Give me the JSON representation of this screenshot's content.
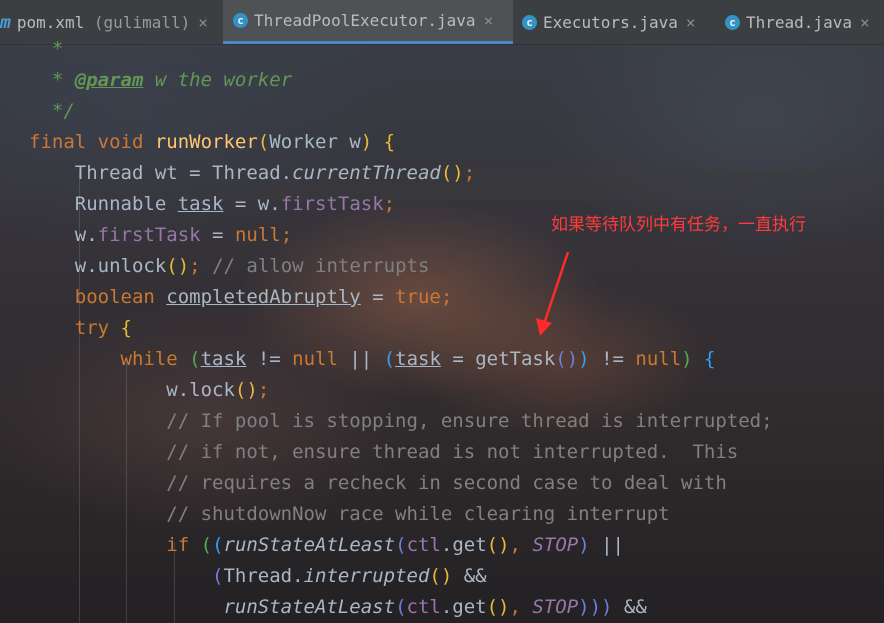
{
  "tabs": [
    {
      "icon": "m",
      "name": "pom.xml",
      "suffix": " (gulimall)",
      "close": "×"
    },
    {
      "icon": "c",
      "name": "ThreadPoolExecutor.java",
      "suffix": "",
      "close": "×"
    },
    {
      "icon": "c",
      "name": "Executors.java",
      "suffix": "",
      "close": "×"
    },
    {
      "icon": "c",
      "name": "Thread.java",
      "suffix": "",
      "close": "×"
    }
  ],
  "annotation": "如果等待队列中有任务，一直执行",
  "colors": {
    "annotation": "#ff3b3b",
    "keyword": "#cc7832",
    "function": "#ffc66d",
    "comment": "#808080",
    "doc": "#629755",
    "field": "#9876aa"
  },
  "code": [
    {
      "indent": "  ",
      "tokens": [
        {
          "t": "*",
          "c": "doc"
        }
      ]
    },
    {
      "indent": "  ",
      "tokens": [
        {
          "t": "* ",
          "c": "doc"
        },
        {
          "t": "@param",
          "c": "tag"
        },
        {
          "t": " w the worker",
          "c": "doc"
        }
      ]
    },
    {
      "indent": "  ",
      "tokens": [
        {
          "t": "*/",
          "c": "doc"
        }
      ]
    },
    {
      "indent": "",
      "tokens": [
        {
          "t": "final void ",
          "c": "kw"
        },
        {
          "t": "runWorker",
          "c": "fn"
        },
        {
          "t": "(",
          "c": "p1"
        },
        {
          "t": "Worker w",
          "c": ""
        },
        {
          "t": ")",
          "c": "p1"
        },
        {
          "t": " {",
          "c": "p1"
        }
      ]
    },
    {
      "indent": "    ",
      "tokens": [
        {
          "t": "Thread wt = Thread.",
          "c": ""
        },
        {
          "t": "currentThread",
          "c": "stat"
        },
        {
          "t": "()",
          "c": "p1"
        },
        {
          "t": ";",
          "c": "kw"
        }
      ]
    },
    {
      "indent": "    ",
      "tokens": [
        {
          "t": "Runnable ",
          "c": ""
        },
        {
          "t": "task",
          "c": "u"
        },
        {
          "t": " = w.",
          "c": ""
        },
        {
          "t": "firstTask",
          "c": "field"
        },
        {
          "t": ";",
          "c": "kw"
        }
      ]
    },
    {
      "indent": "    ",
      "tokens": [
        {
          "t": "w.",
          "c": ""
        },
        {
          "t": "firstTask",
          "c": "field"
        },
        {
          "t": " = ",
          "c": ""
        },
        {
          "t": "null",
          "c": "kw"
        },
        {
          "t": ";",
          "c": "kw"
        }
      ]
    },
    {
      "indent": "    ",
      "tokens": [
        {
          "t": "w.unlock",
          "c": ""
        },
        {
          "t": "()",
          "c": "p1"
        },
        {
          "t": "; ",
          "c": "kw"
        },
        {
          "t": "// allow interrupts",
          "c": "cmt"
        }
      ]
    },
    {
      "indent": "    ",
      "tokens": [
        {
          "t": "boolean ",
          "c": "kw"
        },
        {
          "t": "completedAbruptly",
          "c": "u"
        },
        {
          "t": " = ",
          "c": ""
        },
        {
          "t": "true",
          "c": "kw"
        },
        {
          "t": ";",
          "c": "kw"
        }
      ]
    },
    {
      "indent": "    ",
      "tokens": [
        {
          "t": "try ",
          "c": "kw"
        },
        {
          "t": "{",
          "c": "p1"
        }
      ]
    },
    {
      "indent": "        ",
      "tokens": [
        {
          "t": "while ",
          "c": "kw"
        },
        {
          "t": "(",
          "c": "p2"
        },
        {
          "t": "task",
          "c": "u"
        },
        {
          "t": " != ",
          "c": ""
        },
        {
          "t": "null",
          "c": "kw"
        },
        {
          "t": " || ",
          "c": ""
        },
        {
          "t": "(",
          "c": "p3"
        },
        {
          "t": "task",
          "c": "u"
        },
        {
          "t": " = getTask",
          "c": ""
        },
        {
          "t": "()",
          "c": "p4"
        },
        {
          "t": ")",
          "c": "p3"
        },
        {
          "t": " != ",
          "c": ""
        },
        {
          "t": "null",
          "c": "kw"
        },
        {
          "t": ")",
          "c": "p2"
        },
        {
          "t": " {",
          "c": "p3"
        }
      ]
    },
    {
      "indent": "            ",
      "tokens": [
        {
          "t": "w.lock",
          "c": ""
        },
        {
          "t": "()",
          "c": "p1"
        },
        {
          "t": ";",
          "c": "kw"
        }
      ]
    },
    {
      "indent": "            ",
      "tokens": [
        {
          "t": "// If pool is stopping, ensure thread is interrupted;",
          "c": "cmt"
        }
      ]
    },
    {
      "indent": "            ",
      "tokens": [
        {
          "t": "// if not, ensure thread is not interrupted.  This",
          "c": "cmt"
        }
      ]
    },
    {
      "indent": "            ",
      "tokens": [
        {
          "t": "// requires a recheck in second case to deal with",
          "c": "cmt"
        }
      ]
    },
    {
      "indent": "            ",
      "tokens": [
        {
          "t": "// shutdownNow race while clearing interrupt",
          "c": "cmt"
        }
      ]
    },
    {
      "indent": "            ",
      "tokens": [
        {
          "t": "if ",
          "c": "kw"
        },
        {
          "t": "(",
          "c": "p2"
        },
        {
          "t": "(",
          "c": "p3"
        },
        {
          "t": "runStateAtLeast",
          "c": "stat"
        },
        {
          "t": "(",
          "c": "p4"
        },
        {
          "t": "ctl",
          "c": "field"
        },
        {
          "t": ".get",
          "c": ""
        },
        {
          "t": "()",
          "c": "p1"
        },
        {
          "t": ", ",
          "c": "kw"
        },
        {
          "t": "STOP",
          "c": "cst"
        },
        {
          "t": ")",
          "c": "p4"
        },
        {
          "t": " ||",
          "c": ""
        }
      ]
    },
    {
      "indent": "                ",
      "tokens": [
        {
          "t": "(",
          "c": "p4"
        },
        {
          "t": "Thread.",
          "c": ""
        },
        {
          "t": "interrupted",
          "c": "stat"
        },
        {
          "t": "()",
          "c": "p1"
        },
        {
          "t": " &&",
          "c": ""
        }
      ]
    },
    {
      "indent": "                 ",
      "tokens": [
        {
          "t": "runStateAtLeast",
          "c": "stat"
        },
        {
          "t": "(",
          "c": "p4"
        },
        {
          "t": "ctl",
          "c": "field"
        },
        {
          "t": ".get",
          "c": ""
        },
        {
          "t": "()",
          "c": "p1"
        },
        {
          "t": ", ",
          "c": "kw"
        },
        {
          "t": "STOP",
          "c": "cst"
        },
        {
          "t": ")))",
          "c": "p4"
        },
        {
          "t": " &&",
          "c": ""
        }
      ]
    }
  ]
}
